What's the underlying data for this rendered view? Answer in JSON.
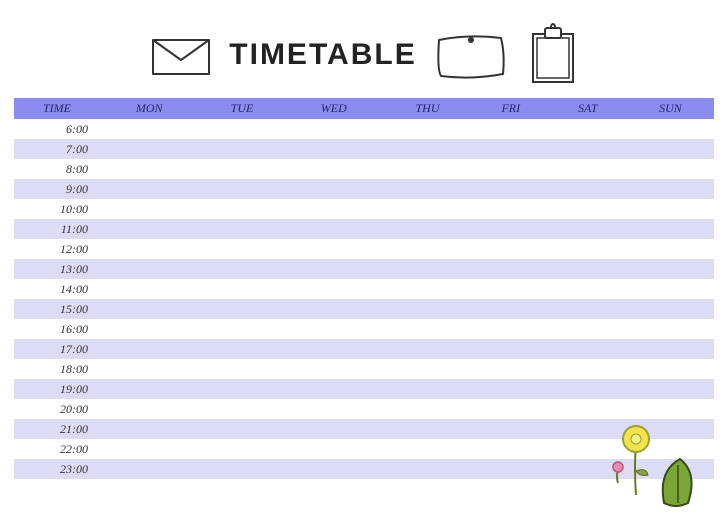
{
  "title": "TIMETABLE",
  "columns": [
    "TIME",
    "MON",
    "TUE",
    "WED",
    "THU",
    "FRI",
    "SAT",
    "SUN"
  ],
  "rows": [
    {
      "time": "6:00",
      "cells": [
        "",
        "",
        "",
        "",
        "",
        "",
        ""
      ]
    },
    {
      "time": "7:00",
      "cells": [
        "",
        "",
        "",
        "",
        "",
        "",
        ""
      ]
    },
    {
      "time": "8:00",
      "cells": [
        "",
        "",
        "",
        "",
        "",
        "",
        ""
      ]
    },
    {
      "time": "9:00",
      "cells": [
        "",
        "",
        "",
        "",
        "",
        "",
        ""
      ]
    },
    {
      "time": "10:00",
      "cells": [
        "",
        "",
        "",
        "",
        "",
        "",
        ""
      ]
    },
    {
      "time": "11:00",
      "cells": [
        "",
        "",
        "",
        "",
        "",
        "",
        ""
      ]
    },
    {
      "time": "12:00",
      "cells": [
        "",
        "",
        "",
        "",
        "",
        "",
        ""
      ]
    },
    {
      "time": "13:00",
      "cells": [
        "",
        "",
        "",
        "",
        "",
        "",
        ""
      ]
    },
    {
      "time": "14:00",
      "cells": [
        "",
        "",
        "",
        "",
        "",
        "",
        ""
      ]
    },
    {
      "time": "15:00",
      "cells": [
        "",
        "",
        "",
        "",
        "",
        "",
        ""
      ]
    },
    {
      "time": "16:00",
      "cells": [
        "",
        "",
        "",
        "",
        "",
        "",
        ""
      ]
    },
    {
      "time": "17:00",
      "cells": [
        "",
        "",
        "",
        "",
        "",
        "",
        ""
      ]
    },
    {
      "time": "18:00",
      "cells": [
        "",
        "",
        "",
        "",
        "",
        "",
        ""
      ]
    },
    {
      "time": "19:00",
      "cells": [
        "",
        "",
        "",
        "",
        "",
        "",
        ""
      ]
    },
    {
      "time": "20:00",
      "cells": [
        "",
        "",
        "",
        "",
        "",
        "",
        ""
      ]
    },
    {
      "time": "21:00",
      "cells": [
        "",
        "",
        "",
        "",
        "",
        "",
        ""
      ]
    },
    {
      "time": "22:00",
      "cells": [
        "",
        "",
        "",
        "",
        "",
        "",
        ""
      ]
    },
    {
      "time": "23:00",
      "cells": [
        "",
        "",
        "",
        "",
        "",
        "",
        ""
      ]
    }
  ]
}
